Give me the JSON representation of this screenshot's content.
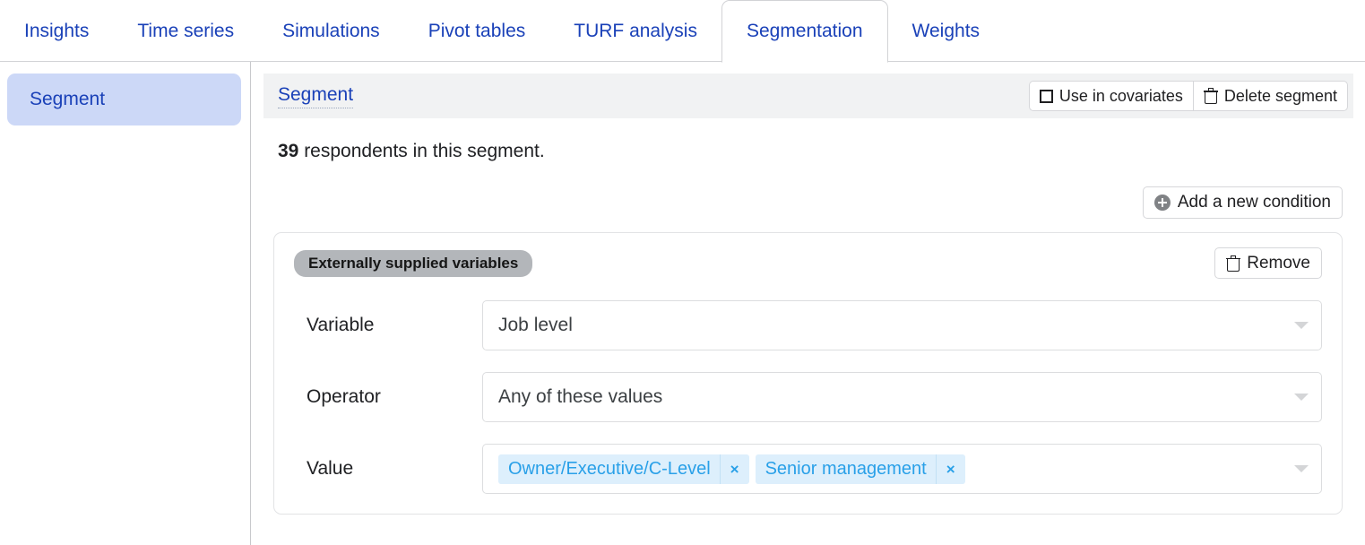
{
  "tabs": [
    {
      "label": "Insights",
      "active": false
    },
    {
      "label": "Time series",
      "active": false
    },
    {
      "label": "Simulations",
      "active": false
    },
    {
      "label": "Pivot tables",
      "active": false
    },
    {
      "label": "TURF analysis",
      "active": false
    },
    {
      "label": "Segmentation",
      "active": true
    },
    {
      "label": "Weights",
      "active": false
    }
  ],
  "sidebar": {
    "items": [
      {
        "label": "Segment"
      }
    ]
  },
  "panel": {
    "title": "Segment",
    "use_in_covariates_label": "Use in covariates",
    "use_in_covariates_checked": false,
    "delete_segment_label": "Delete segment",
    "respondents_count": "39",
    "respondents_text": " respondents in this segment.",
    "add_condition_label": "Add a new condition"
  },
  "condition": {
    "badge": "Externally supplied variables",
    "remove_label": "Remove",
    "fields": [
      {
        "label": "Variable",
        "value": "Job level"
      },
      {
        "label": "Operator",
        "value": "Any of these values"
      }
    ],
    "value_field": {
      "label": "Value",
      "chips": [
        {
          "label": "Owner/Executive/C-Level",
          "remove": "×"
        },
        {
          "label": "Senior management",
          "remove": "×"
        }
      ]
    }
  },
  "colors": {
    "tab_link": "#1a41b8",
    "sidebar_active_bg": "#ccd8f7",
    "panel_head_bg": "#f1f2f3",
    "badge_bg": "#b3b6ba",
    "chip_bg": "#ddeffc",
    "chip_text": "#29a0e8"
  }
}
